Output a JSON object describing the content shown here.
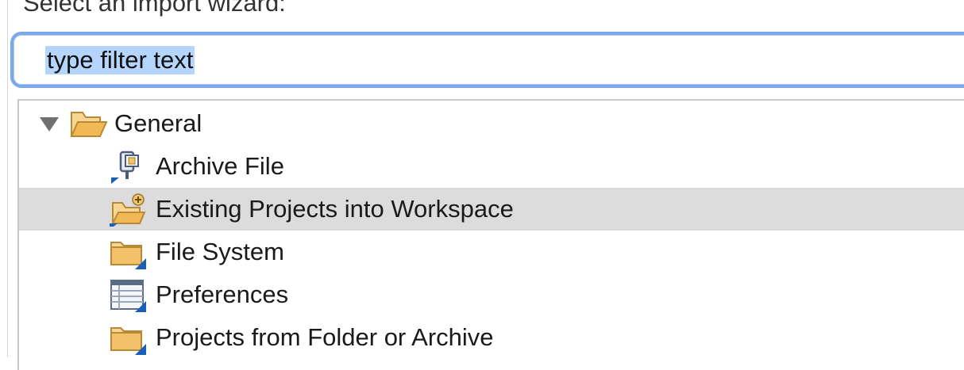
{
  "wizard": {
    "prompt": "Select an import wizard:"
  },
  "filter": {
    "value": "type filter text"
  },
  "tree": {
    "category": {
      "label": "General",
      "icon": "open-folder-icon",
      "expanded": true
    },
    "items": [
      {
        "label": "Archive File",
        "icon": "archive-file-icon",
        "selected": false
      },
      {
        "label": "Existing Projects into Workspace",
        "icon": "existing-projects-icon",
        "selected": true
      },
      {
        "label": "File System",
        "icon": "file-system-folder-icon",
        "selected": false
      },
      {
        "label": "Preferences",
        "icon": "preferences-table-icon",
        "selected": false
      },
      {
        "label": "Projects from Folder or Archive",
        "icon": "projects-folder-icon",
        "selected": false
      }
    ]
  },
  "colors": {
    "focus_ring": "#7ba7ec",
    "text_selection": "#b5d5fd",
    "row_selection": "#dcdcdc",
    "folder": "#f3c46a",
    "import_arrow": "#1c5fb8"
  }
}
